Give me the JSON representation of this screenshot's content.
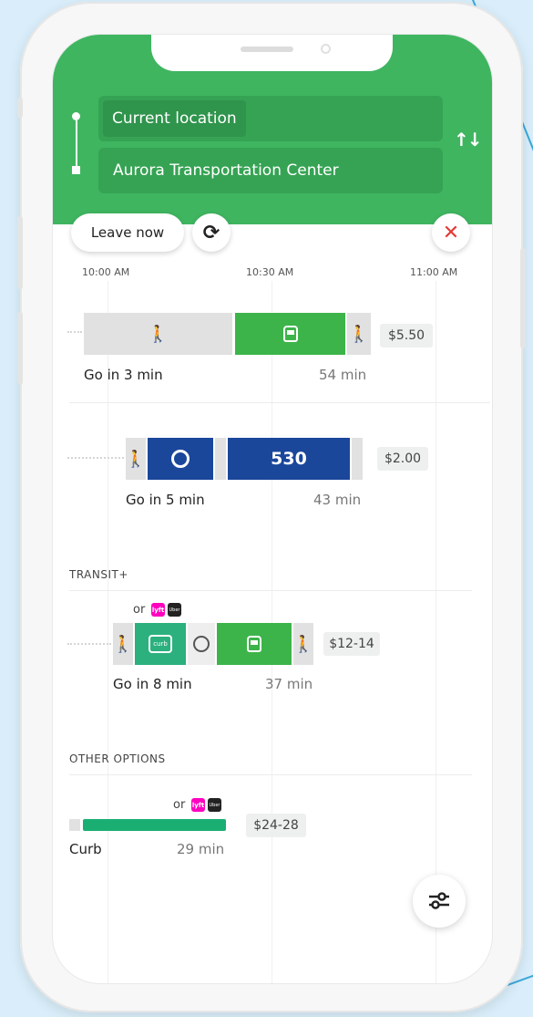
{
  "search": {
    "origin": "Current location",
    "destination": "Aurora Transportation Center"
  },
  "controls": {
    "leave_now": "Leave now"
  },
  "timeline": {
    "ticks": [
      "10:00 AM",
      "10:30 AM",
      "11:00 AM"
    ]
  },
  "trips": [
    {
      "fare": "$5.50",
      "go": "Go in 3 min",
      "duration": "54 min"
    },
    {
      "fare": "$2.00",
      "go": "Go in 5 min",
      "duration": "43 min",
      "route": "530"
    }
  ],
  "transit_plus": {
    "title": "TRANSIT+",
    "or": "or",
    "fare": "$12-14",
    "go": "Go in 8 min",
    "duration": "37 min",
    "curb_label": "curb"
  },
  "other_options": {
    "title": "OTHER OPTIONS",
    "or": "or",
    "fare": "$24-28",
    "name": "Curb",
    "duration": "29 min"
  },
  "brands": {
    "lyft": "lyft",
    "uber": "Uber"
  },
  "colors": {
    "header_green": "#3fb560",
    "train_green": "#3cb44a",
    "bus_blue": "#1b479b",
    "curb_teal": "#1aae73",
    "close_red": "#e53935"
  }
}
